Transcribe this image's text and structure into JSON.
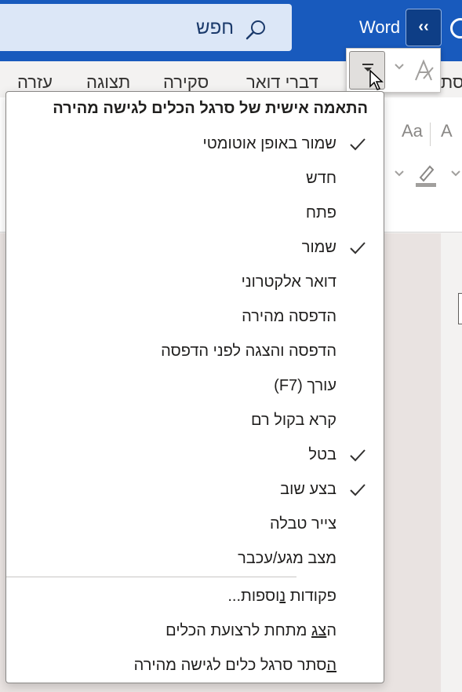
{
  "titlebar": {
    "search_text": "חפש",
    "app_name": "Word",
    "collapse_label": "‹‹"
  },
  "ribbon": {
    "tabs": [
      "עזרה",
      "תצוגה",
      "סקירה",
      "דברי דואר",
      "סת"
    ],
    "glyphs": [
      "Aa",
      "A"
    ]
  },
  "menu": {
    "title": "התאמה אישית של סרגל הכלים לגישה מהירה",
    "items": [
      {
        "label": "שמור באופן אוטומטי",
        "checked": true
      },
      {
        "label": "חדש",
        "checked": false
      },
      {
        "label": "פתח",
        "checked": false
      },
      {
        "label": "שמור",
        "checked": true
      },
      {
        "label": "דואר אלקטרוני",
        "checked": false
      },
      {
        "label": "הדפסה מהירה",
        "checked": false
      },
      {
        "label": "הדפסה והצגה לפני הדפסה",
        "checked": false
      },
      {
        "label": "עורך (F7)",
        "checked": false
      },
      {
        "label": "קרא בקול רם",
        "checked": false
      },
      {
        "label": "בטל",
        "checked": true
      },
      {
        "label": "בצע שוב",
        "checked": true
      },
      {
        "label": "צייר טבלה",
        "checked": false
      },
      {
        "label": "מצב מגע/עכבר",
        "checked": false
      }
    ],
    "more_commands": {
      "prefix": "פקודות ",
      "key": "נ",
      "suffix": "וספות..."
    },
    "show_below": {
      "prefix": "ה",
      "key": "צג",
      "suffix": " מתחת לרצועת הכלים"
    },
    "hide_toolbar": {
      "prefix": "",
      "key": "ה",
      "suffix": "סתר סרגל כלים לגישה מהירה"
    }
  },
  "colors": {
    "titlebar": "#185abd",
    "accent": "#0e3e86",
    "menu_text": "#201f1e"
  },
  "icons": {
    "search": "search-icon",
    "check": "checkmark-icon",
    "customize_dropdown": "customize-qat-dropdown-icon",
    "format_painter": "format-painter-icon"
  }
}
